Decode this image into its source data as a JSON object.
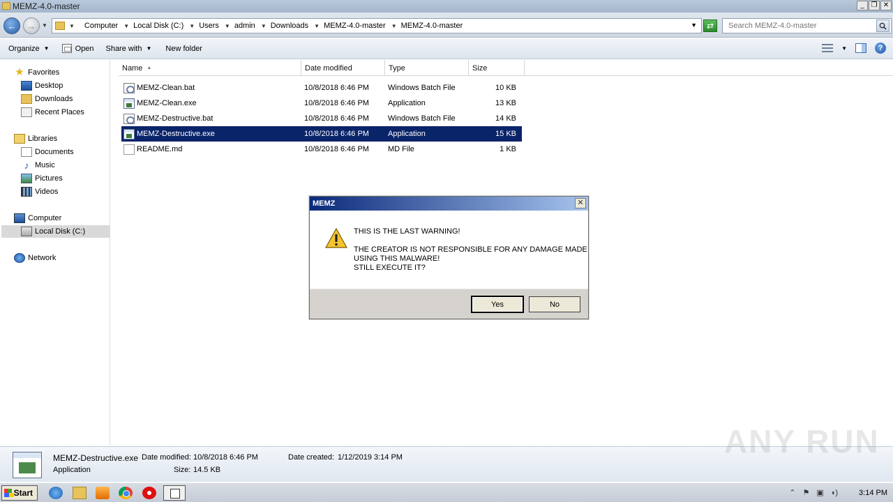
{
  "window": {
    "title": "MEMZ-4.0-master"
  },
  "address": {
    "crumbs": [
      "Computer",
      "Local Disk (C:)",
      "Users",
      "admin",
      "Downloads",
      "MEMZ-4.0-master",
      "MEMZ-4.0-master"
    ]
  },
  "search": {
    "placeholder": "Search MEMZ-4.0-master"
  },
  "toolbar": {
    "organize": "Organize",
    "open": "Open",
    "share_with": "Share with",
    "new_folder": "New folder"
  },
  "nav": {
    "favorites": "Favorites",
    "desktop": "Desktop",
    "downloads": "Downloads",
    "recent_places": "Recent Places",
    "libraries": "Libraries",
    "documents": "Documents",
    "music": "Music",
    "pictures": "Pictures",
    "videos": "Videos",
    "computer": "Computer",
    "local_disk": "Local Disk (C:)",
    "network": "Network"
  },
  "columns": {
    "name": "Name",
    "date": "Date modified",
    "type": "Type",
    "size": "Size"
  },
  "files": [
    {
      "name": "MEMZ-Clean.bat",
      "date": "10/8/2018 6:46 PM",
      "type": "Windows Batch File",
      "size": "10 KB"
    },
    {
      "name": "MEMZ-Clean.exe",
      "date": "10/8/2018 6:46 PM",
      "type": "Application",
      "size": "13 KB"
    },
    {
      "name": "MEMZ-Destructive.bat",
      "date": "10/8/2018 6:46 PM",
      "type": "Windows Batch File",
      "size": "14 KB"
    },
    {
      "name": "MEMZ-Destructive.exe",
      "date": "10/8/2018 6:46 PM",
      "type": "Application",
      "size": "15 KB"
    },
    {
      "name": "README.md",
      "date": "10/8/2018 6:46 PM",
      "type": "MD File",
      "size": "1 KB"
    }
  ],
  "dialog": {
    "title": "MEMZ",
    "line1": "THIS IS THE LAST WARNING!",
    "line2": "THE CREATOR IS NOT RESPONSIBLE FOR ANY DAMAGE MADE",
    "line3": "USING THIS MALWARE!",
    "line4": "STILL EXECUTE IT?",
    "yes": "Yes",
    "no": "No"
  },
  "details": {
    "filename": "MEMZ-Destructive.exe",
    "filetype": "Application",
    "modified_label": "Date modified:",
    "modified": "10/8/2018 6:46 PM",
    "created_label": "Date created:",
    "created": "1/12/2019 3:14 PM",
    "size_label": "Size:",
    "size": "14.5 KB"
  },
  "watermark": "ANY RUN",
  "taskbar": {
    "start": "Start",
    "clock": "3:14 PM"
  },
  "colors": {
    "selection": "#0a246a",
    "title_bar": "#b9c9dc",
    "dialog_title": "#0b2a7a"
  }
}
